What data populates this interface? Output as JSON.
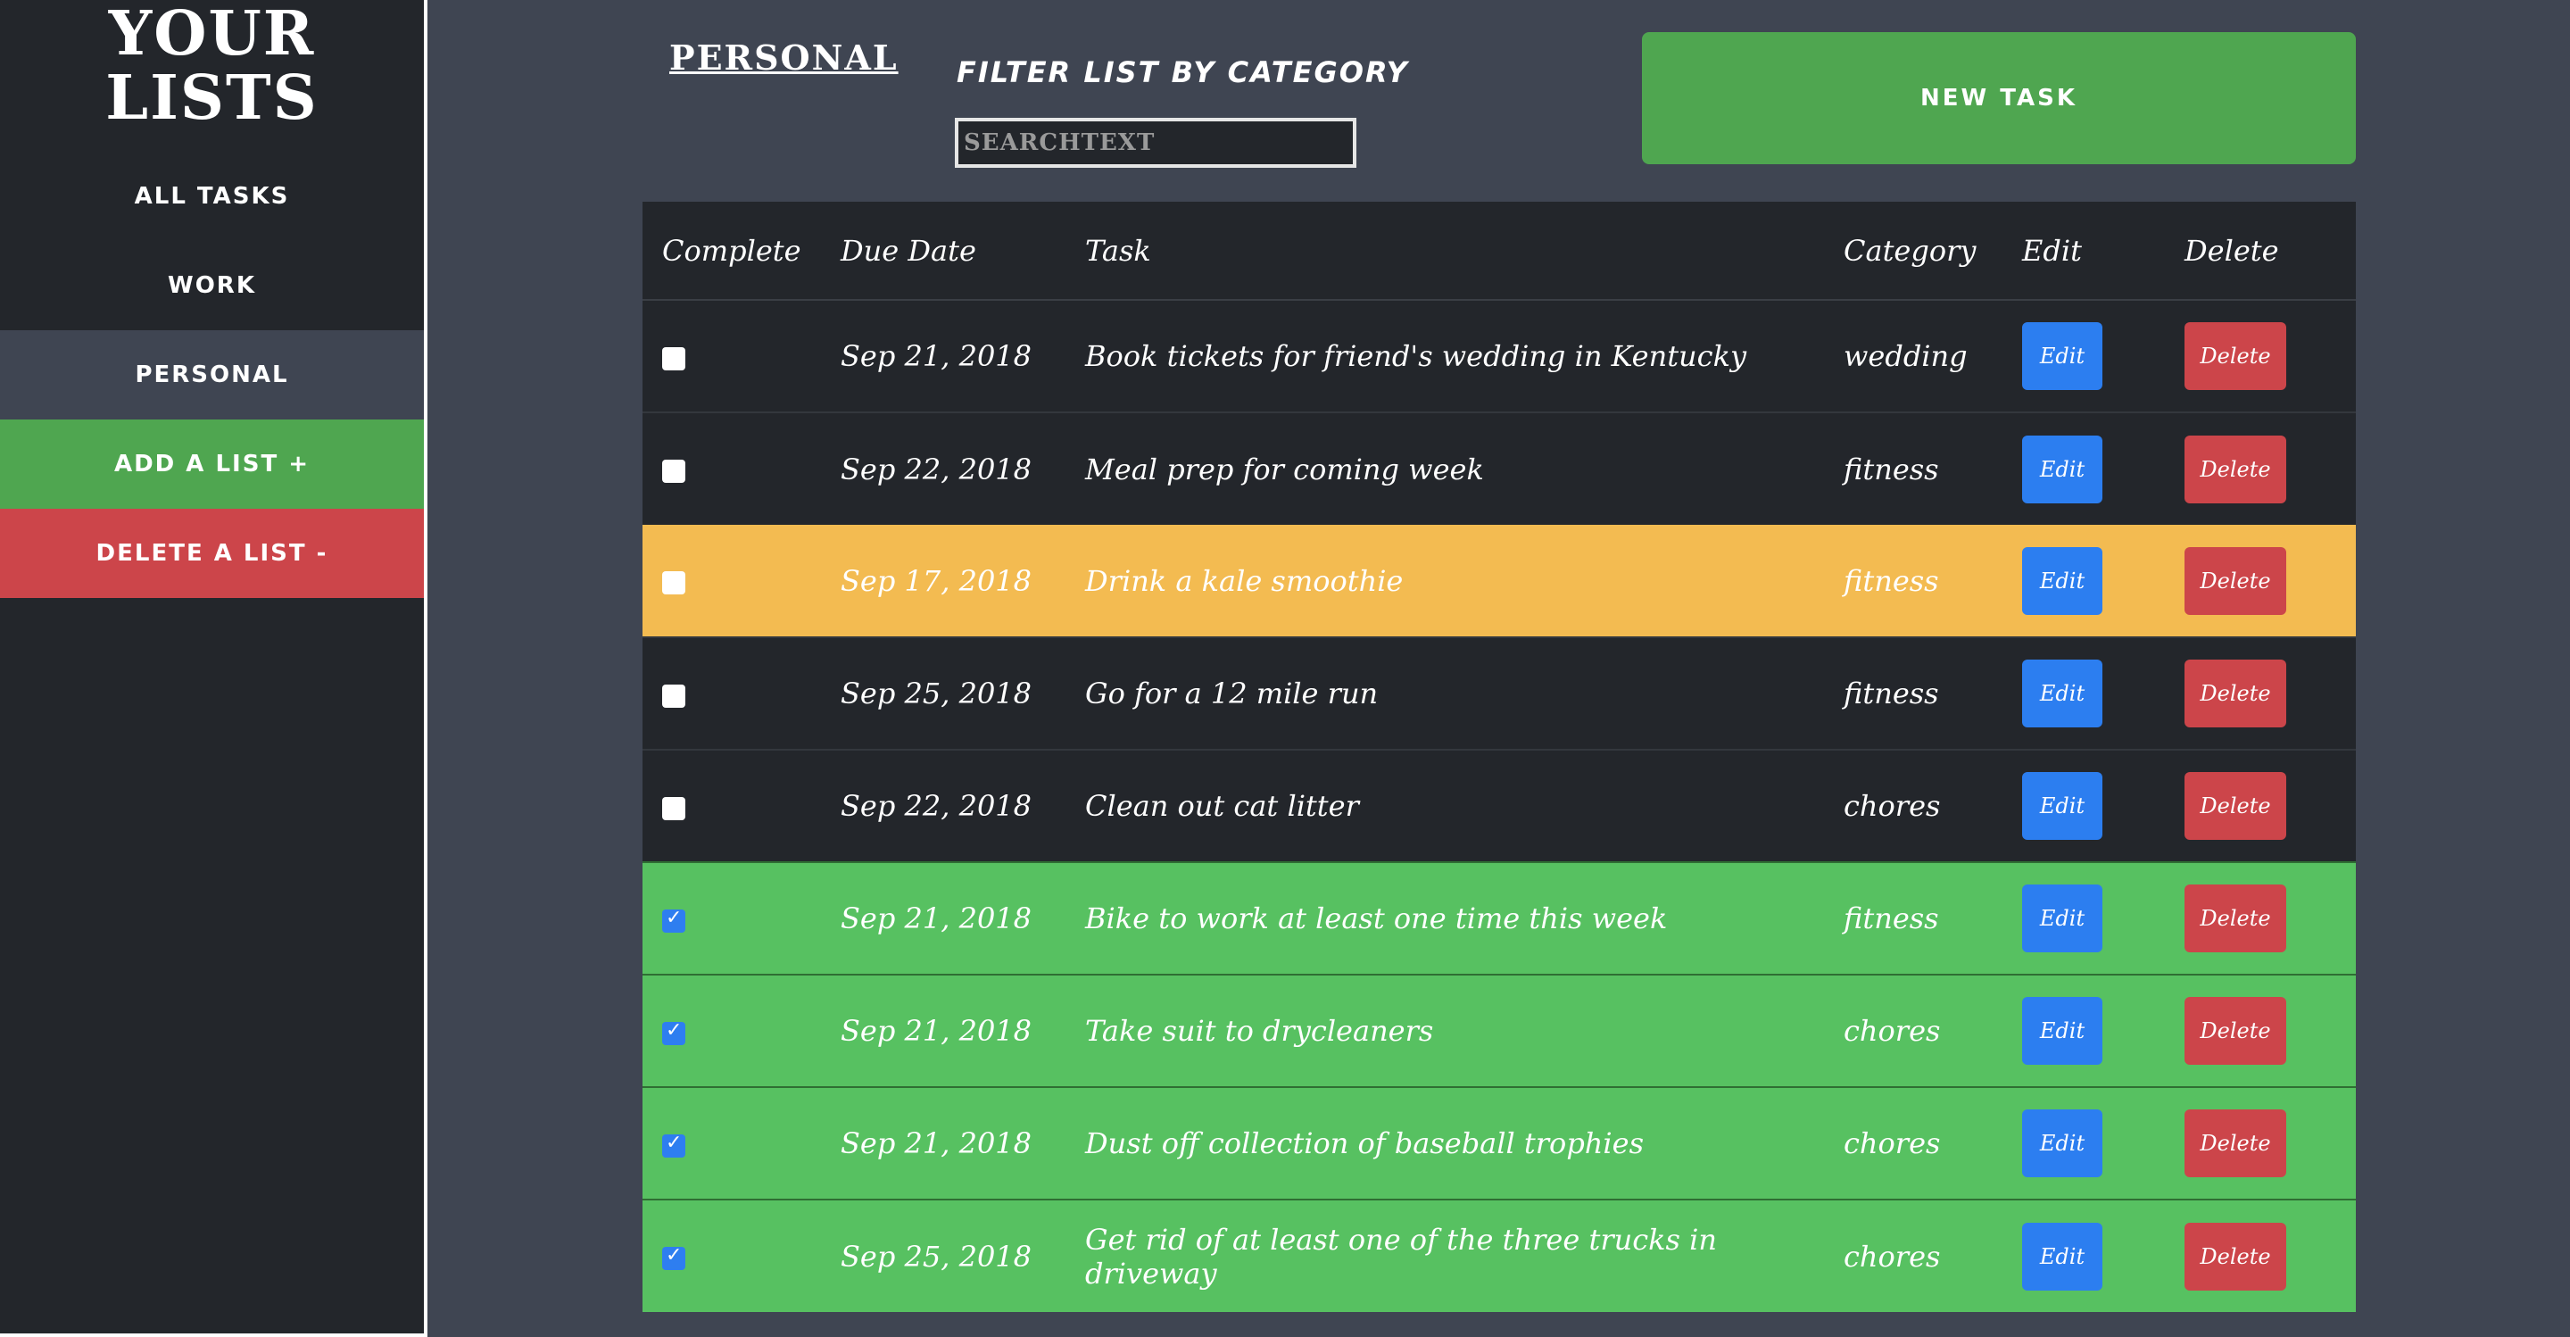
{
  "sidebar": {
    "brand_line1": "Your",
    "brand_line2": "Lists",
    "items": [
      {
        "label": "All Tasks"
      },
      {
        "label": "Work"
      },
      {
        "label": "Personal"
      },
      {
        "label": "Add a List +"
      },
      {
        "label": "Delete a List -"
      }
    ]
  },
  "header": {
    "list_title": "Personal",
    "filter_label": "Filter List by Category",
    "search_placeholder": "SEARCHTEXT",
    "new_task_label": "New Task"
  },
  "table": {
    "columns": [
      "Complete",
      "Due Date",
      "Task",
      "Category",
      "Edit",
      "Delete"
    ],
    "edit_label": "Edit",
    "delete_label": "Delete",
    "rows": [
      {
        "complete": false,
        "due": "Sep 21, 2018",
        "task": "Book tickets for friend's wedding in Kentucky",
        "category": "wedding",
        "status": "dark"
      },
      {
        "complete": false,
        "due": "Sep 22, 2018",
        "task": "Meal prep for coming week",
        "category": "fitness",
        "status": "dark"
      },
      {
        "complete": false,
        "due": "Sep 17, 2018",
        "task": "Drink a kale smoothie",
        "category": "fitness",
        "status": "warn"
      },
      {
        "complete": false,
        "due": "Sep 25, 2018",
        "task": "Go for a 12 mile run",
        "category": "fitness",
        "status": "dark"
      },
      {
        "complete": false,
        "due": "Sep 22, 2018",
        "task": "Clean out cat litter",
        "category": "chores",
        "status": "dark"
      },
      {
        "complete": true,
        "due": "Sep 21, 2018",
        "task": "Bike to work at least one time this week",
        "category": "fitness",
        "status": "done"
      },
      {
        "complete": true,
        "due": "Sep 21, 2018",
        "task": "Take suit to drycleaners",
        "category": "chores",
        "status": "done"
      },
      {
        "complete": true,
        "due": "Sep 21, 2018",
        "task": "Dust off collection of baseball trophies",
        "category": "chores",
        "status": "done"
      },
      {
        "complete": true,
        "due": "Sep 25, 2018",
        "task": "Get rid of at least one of the three trucks in driveway",
        "category": "chores",
        "status": "done"
      }
    ]
  },
  "colors": {
    "background": "#3f4552",
    "sidebar": "#23262b",
    "green": "#4fa650",
    "done_row": "#57c161",
    "warn_row": "#f3bb51",
    "red": "#cc454a",
    "blue": "#2c7ef0"
  }
}
